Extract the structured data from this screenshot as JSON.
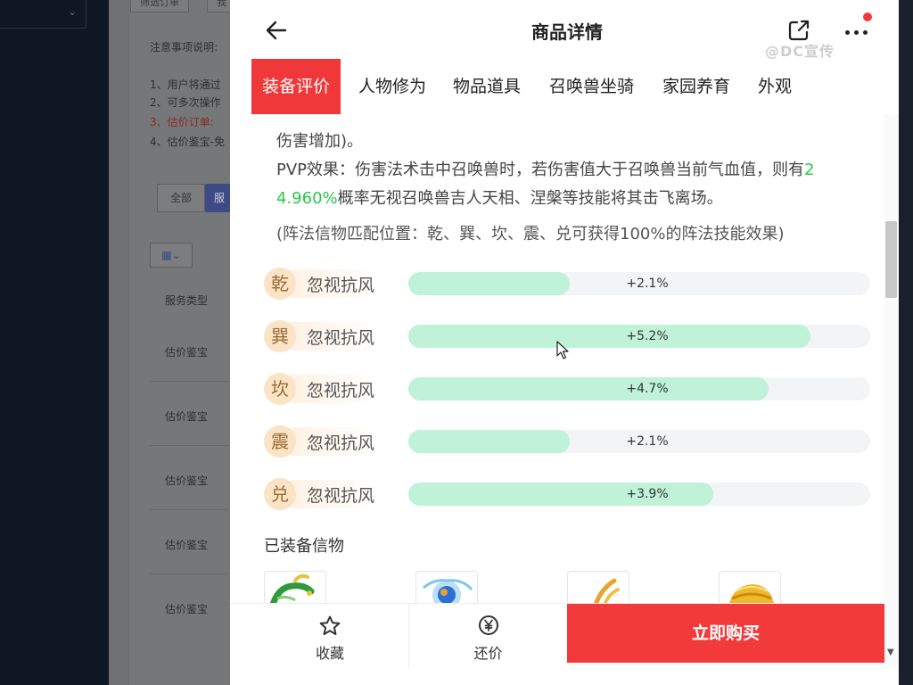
{
  "background": {
    "tabs": [
      "筛选订单",
      "我"
    ],
    "notice_title": "注意事项说明:",
    "notice_items": [
      "1、用户将通过",
      "2、可多次操作",
      "3、估价订单:",
      "4、估价鉴宝-免"
    ],
    "filter_all": "全部",
    "filter_active": "服",
    "table_header": "服务类型",
    "rows": [
      "估价鉴宝",
      "估价鉴宝",
      "估价鉴宝",
      "估价鉴宝",
      "估价鉴宝"
    ]
  },
  "header": {
    "title": "商品详情",
    "watermark": "@DC宣传"
  },
  "tabs": [
    {
      "label": "装备评价",
      "active": true
    },
    {
      "label": "人物修为",
      "active": false
    },
    {
      "label": "物品道具",
      "active": false
    },
    {
      "label": "召唤兽坐骑",
      "active": false
    },
    {
      "label": "家园养育",
      "active": false
    },
    {
      "label": "外观",
      "active": false
    }
  ],
  "description": {
    "line1": "伤害增加)。",
    "line2_prefix": "PVP效果：伤害法术击中召唤兽时，若伤害值大于召唤兽当前气血值，则有",
    "line2_green": "2",
    "line3_green": "4.960%",
    "line3_suffix": "概率无视召唤兽吉人天相、涅槃等技能将其击飞离场。",
    "note": "(阵法信物匹配位置：乾、巽、坎、震、兑可获得100%的阵法技能效果)"
  },
  "attributes": [
    {
      "position": "乾",
      "label": "忽视抗风",
      "value": "+2.1%",
      "fill": 0.35
    },
    {
      "position": "巽",
      "label": "忽视抗风",
      "value": "+5.2%",
      "fill": 0.87
    },
    {
      "position": "坎",
      "label": "忽视抗风",
      "value": "+4.7%",
      "fill": 0.78
    },
    {
      "position": "震",
      "label": "忽视抗风",
      "value": "+2.1%",
      "fill": 0.35
    },
    {
      "position": "兑",
      "label": "忽视抗风",
      "value": "+3.9%",
      "fill": 0.66
    }
  ],
  "equipped_section": {
    "title": "已装备信物",
    "items": [
      "green-dragon-item",
      "blue-orb-item",
      "golden-claw-item",
      "golden-helmet-item"
    ]
  },
  "bottom_bar": {
    "favorite_label": "收藏",
    "bargain_label": "还价",
    "buy_label": "立即购买"
  },
  "colors": {
    "accent": "#f23a3a",
    "green_text": "#27c94a",
    "bar_fill": "#bff2d8",
    "badge": "#fbe3c6"
  }
}
